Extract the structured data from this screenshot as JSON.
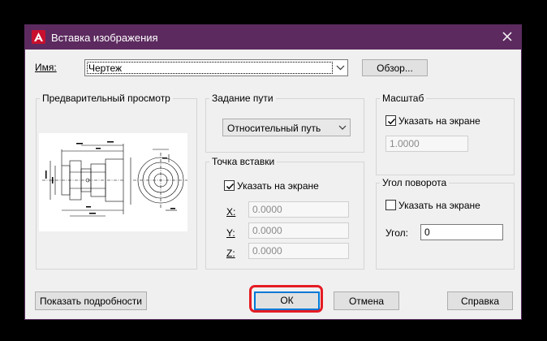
{
  "dialog": {
    "title": "Вставка изображения",
    "icons": {
      "app": "autocad-icon",
      "close": "close-icon"
    }
  },
  "name_row": {
    "label": "Имя:",
    "value": "Чертеж",
    "browse_label": "Обзор..."
  },
  "preview": {
    "title": "Предварительный просмотр"
  },
  "path": {
    "title": "Задание пути",
    "selected": "Относительный путь"
  },
  "insertion": {
    "title": "Точка вставки",
    "on_screen_label": "Указать на экране",
    "on_screen_checked": true,
    "x_label": "X:",
    "x_value": "0.0000",
    "y_label": "Y:",
    "y_value": "0.0000",
    "z_label": "Z:",
    "z_value": "0.0000"
  },
  "scale": {
    "title": "Масштаб",
    "on_screen_label": "Указать на экране",
    "on_screen_checked": true,
    "value": "1.0000"
  },
  "rotation": {
    "title": "Угол поворота",
    "on_screen_label": "Указать на экране",
    "on_screen_checked": false,
    "angle_label": "Угол:",
    "angle_value": "0"
  },
  "footer": {
    "details_label": "Показать подробности",
    "ok_label": "ОК",
    "cancel_label": "Отмена",
    "help_label": "Справка"
  },
  "colors": {
    "titlebar": "#5c2a5f",
    "highlight": "#e51c23",
    "app_icon": "#c8102e"
  }
}
